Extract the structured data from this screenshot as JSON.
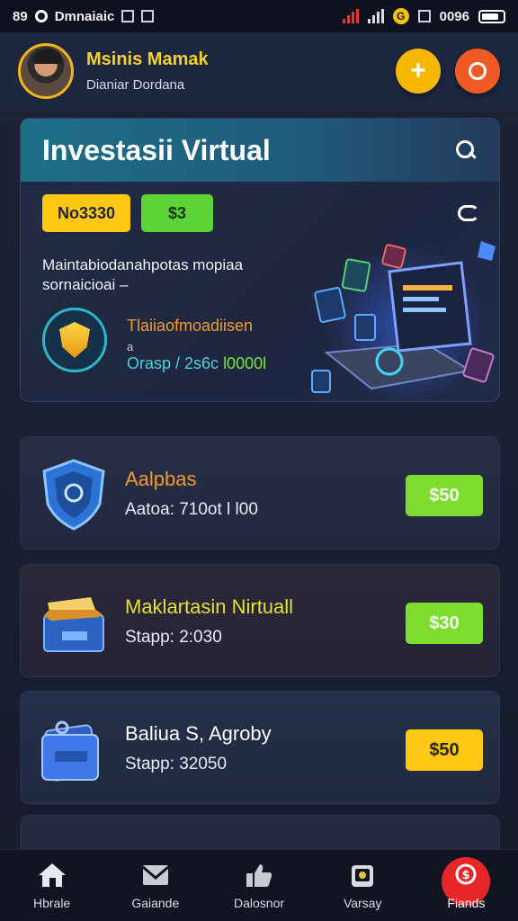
{
  "status_bar": {
    "time": "89",
    "carrier": "Dmnaiaic",
    "clock": "0096",
    "coin": "G"
  },
  "header": {
    "user_name": "Msinis Mamak",
    "user_sub": "Dianiar Dordana",
    "add_label": "+"
  },
  "hero": {
    "title": "Investasii Virtual",
    "tag_yellow": "No3330",
    "tag_green": "$3",
    "description_line1": "Maintabiodanahpotas mopiaa",
    "description_line2": "sornaicioai –",
    "badge_title": "Tlaiiaofmoadiisen",
    "badge_sub": "a",
    "badge_line": "Orasp / 2s6c",
    "badge_highlight": "l0000l"
  },
  "items": [
    {
      "title": "Aalpbas",
      "meta": "Aatoa: 710ot l l00",
      "price": "$50",
      "title_color": "#f39c2b",
      "price_color": "green"
    },
    {
      "title": "Maklartasin Nirtuall",
      "meta": "Stapp: 2:030",
      "price": "$30",
      "title_color": "#e8e12c",
      "price_color": "green"
    },
    {
      "title": "Baliua S, Agroby",
      "meta": "Stapp: 32050",
      "price": "$50",
      "title_color": "#ffffff",
      "price_color": "yellow"
    }
  ],
  "nav": [
    {
      "label": "Hbrale",
      "icon": "home-icon"
    },
    {
      "label": "Gaiande",
      "icon": "mail-icon"
    },
    {
      "label": "Dalosnor",
      "icon": "thumbs-up-icon"
    },
    {
      "label": "Varsay",
      "icon": "wallet-icon"
    },
    {
      "label": "Fiands",
      "icon": "dollar-icon"
    }
  ]
}
